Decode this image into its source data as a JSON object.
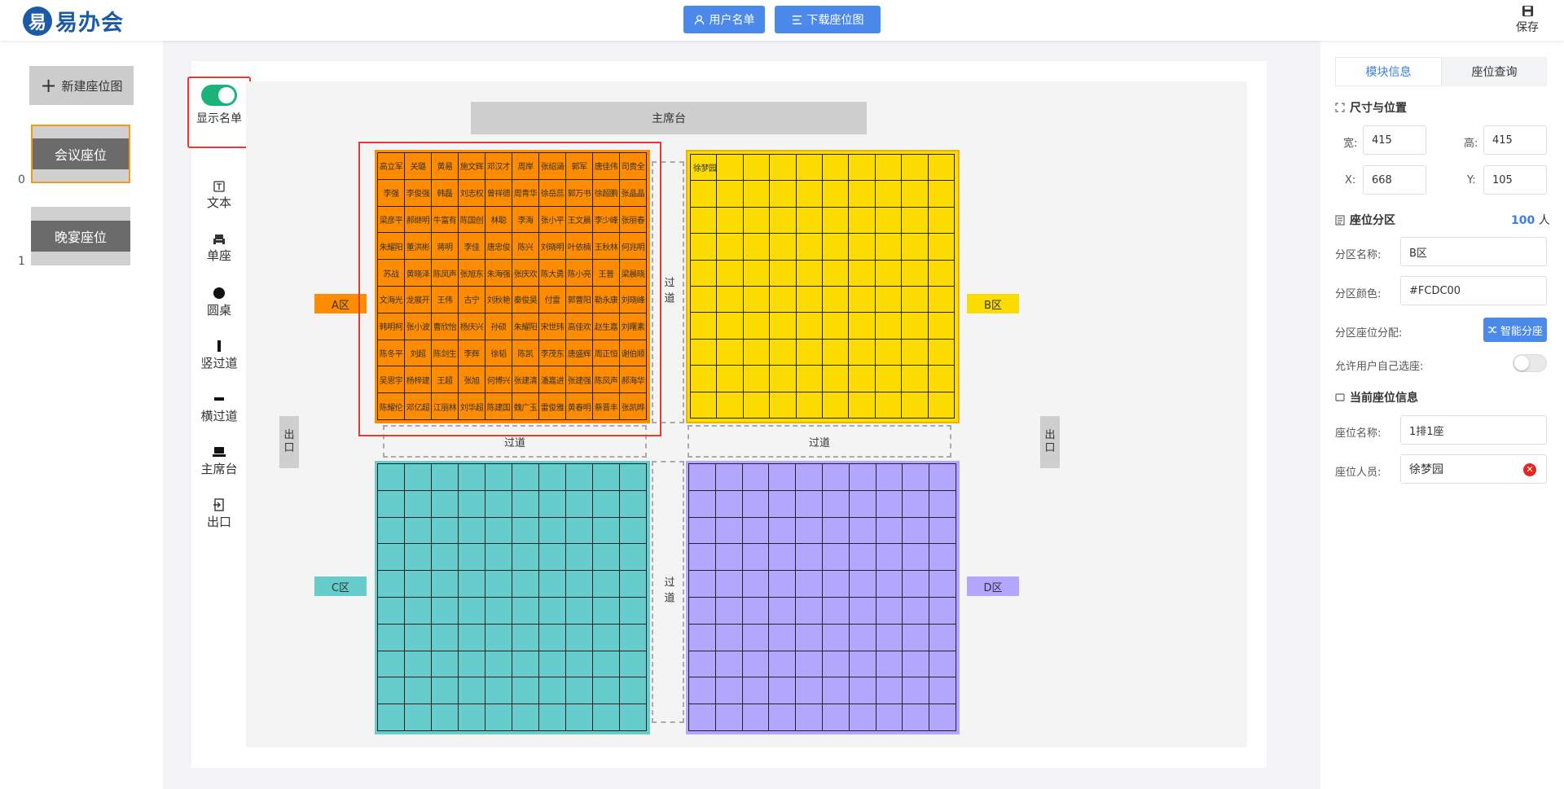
{
  "header": {
    "logo_glyph": "易",
    "logo_text": "易办会",
    "user_list_label": "用户名单",
    "download_label": "下载座位图",
    "save_label": "保存"
  },
  "left": {
    "new_label": "新建座位图",
    "layouts": [
      {
        "index": "0",
        "label": "会议座位",
        "selected": true
      },
      {
        "index": "1",
        "label": "晚宴座位",
        "selected": false
      }
    ]
  },
  "tools": {
    "toggle_label": "显示名单",
    "items": [
      "文本",
      "单座",
      "圆桌",
      "竖过道",
      "横过道",
      "主席台",
      "出口"
    ]
  },
  "stage": {
    "dais": "主席台",
    "exit": "出口",
    "aisle": "过道",
    "zones": [
      {
        "id": "a",
        "label": "A区",
        "color": "#FF8C00"
      },
      {
        "id": "b",
        "label": "B区",
        "color": "#FCDC00"
      },
      {
        "id": "c",
        "label": "C区",
        "color": "#66CCCC"
      },
      {
        "id": "d",
        "label": "D区",
        "color": "#B3A6FF"
      }
    ],
    "zone_a_names": [
      [
        "高立军",
        "关璐",
        "黄易",
        "施文辉",
        "邓汉才",
        "周岸",
        "张绍涵",
        "郭军",
        "唐佳伟",
        "司贵全"
      ],
      [
        "李强",
        "李俊强",
        "韩磊",
        "刘志权",
        "曾祥德",
        "周青华",
        "徐岳蕊",
        "郭万书",
        "徐超鹏",
        "张晶晶"
      ],
      [
        "梁彦平",
        "郝继明",
        "牛富有",
        "陈国创",
        "林聪",
        "李海",
        "张小平",
        "王文晨",
        "李少峰",
        "张丽春"
      ],
      [
        "朱耀阳",
        "董洪彬",
        "蒋明",
        "李佳",
        "唐忠俊",
        "陈兴",
        "刘晓明",
        "叶依楠",
        "王秋林",
        "何兆明"
      ],
      [
        "苏战",
        "黄晓泽",
        "陈凤声",
        "张旭东",
        "朱海强",
        "张庆欢",
        "陈大勇",
        "陈小亮",
        "王普",
        "梁晨晓"
      ],
      [
        "文海光",
        "龙展开",
        "王伟",
        "古宁",
        "刘秋艳",
        "秦俊昊",
        "付雷",
        "郭曹阳",
        "勒永康",
        "刘晓峰"
      ],
      [
        "韩明柯",
        "张小波",
        "曹欣怡",
        "杨庆兴",
        "孙硕",
        "朱耀阳",
        "宋世玮",
        "高佳欢",
        "赵生嘉",
        "刘曙素"
      ],
      [
        "陈冬平",
        "刘超",
        "陈剑生",
        "李辉",
        "徐韬",
        "陈凯",
        "李茂东",
        "唐盛辉",
        "周正恒",
        "谢伯顺"
      ],
      [
        "吴思宇",
        "杨梓建",
        "王超",
        "张旭",
        "何博兴",
        "张建清",
        "潘嘉进",
        "张建强",
        "陈凤声",
        "郝海华"
      ],
      [
        "陈耀伦",
        "邓亿超",
        "江丽林",
        "刘华超",
        "陈建国",
        "魏广玉",
        "雷俊雅",
        "黄春明",
        "蔡晋丰",
        "张凯晔"
      ]
    ],
    "zone_b_first_seat": "徐梦园"
  },
  "panel": {
    "tab_module": "模块信息",
    "tab_query": "座位查询",
    "size_title": "尺寸与位置",
    "w_label": "宽:",
    "w_value": "415",
    "h_label": "高:",
    "h_value": "415",
    "x_label": "X:",
    "x_value": "668",
    "y_label": "Y:",
    "y_value": "105",
    "zone_title": "座位分区",
    "zone_count": "100",
    "zone_count_unit": "人",
    "zone_name_label": "分区名称:",
    "zone_name_value": "B区",
    "zone_color_label": "分区颜色:",
    "zone_color_value": "#FCDC00",
    "zone_assign_label": "分区座位分配:",
    "smart_label": "智能分座",
    "allow_label": "允许用户自己选座:",
    "current_title": "当前座位信息",
    "seat_name_label": "座位名称:",
    "seat_name_value": "1排1座",
    "seat_person_label": "座位人员:",
    "seat_person_value": "徐梦园"
  },
  "icons": [
    "logo-icon",
    "user-icon",
    "list-icon",
    "save-icon",
    "plus-icon",
    "text-icon",
    "seat-icon",
    "round-table-icon",
    "vertical-aisle-icon",
    "horizontal-aisle-icon",
    "dais-icon",
    "exit-icon",
    "expand-icon",
    "zone-icon",
    "seat-info-icon",
    "shuffle-icon",
    "clear-icon"
  ]
}
